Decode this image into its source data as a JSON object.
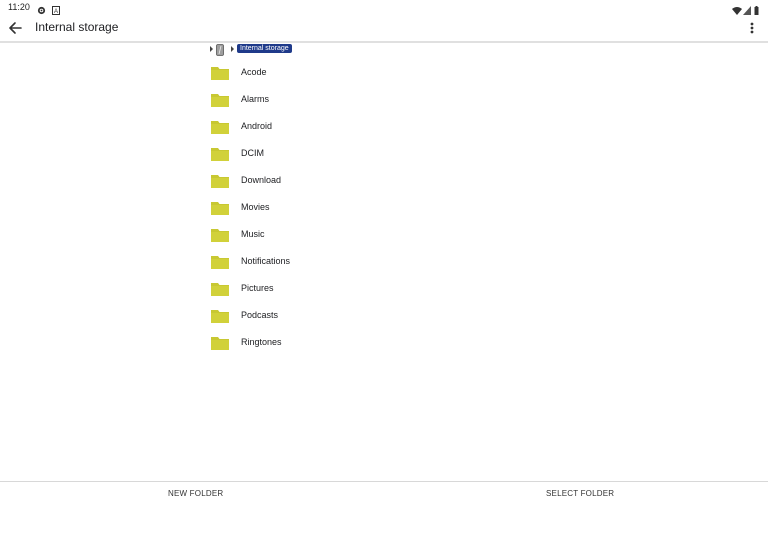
{
  "status_bar": {
    "time": "11:20"
  },
  "app_bar": {
    "title": "Internal storage"
  },
  "breadcrumb": {
    "current": "Internal storage"
  },
  "folders": [
    {
      "name": "Acode"
    },
    {
      "name": "Alarms"
    },
    {
      "name": "Android"
    },
    {
      "name": "DCIM"
    },
    {
      "name": "Download"
    },
    {
      "name": "Movies"
    },
    {
      "name": "Music"
    },
    {
      "name": "Notifications"
    },
    {
      "name": "Pictures"
    },
    {
      "name": "Podcasts"
    },
    {
      "name": "Ringtones"
    }
  ],
  "actions": {
    "new_folder": "NEW FOLDER",
    "select_folder": "SELECT FOLDER"
  },
  "colors": {
    "folder": "#c8c832",
    "breadcrumb_bg": "#1f3a8a"
  }
}
